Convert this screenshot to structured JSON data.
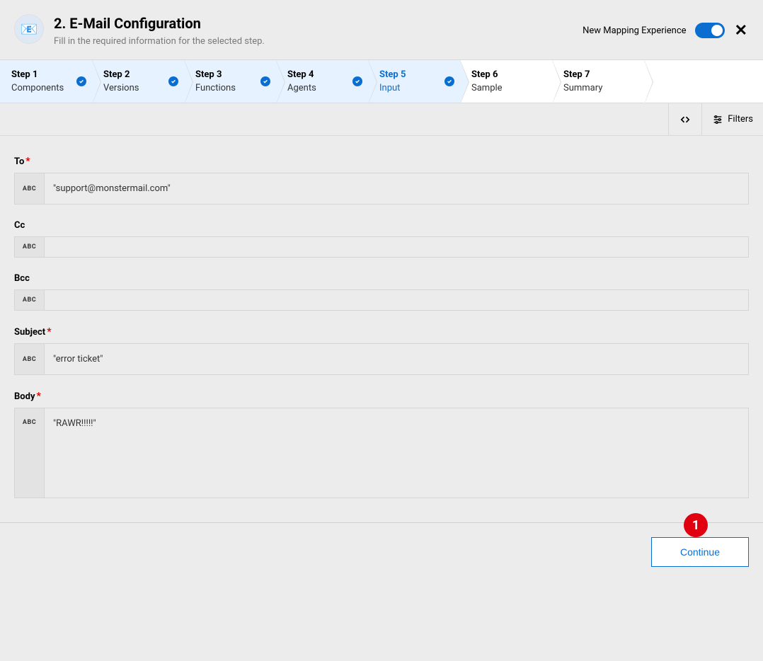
{
  "header": {
    "title": "2. E-Mail Configuration",
    "subtitle": "Fill in the required information for the selected step.",
    "icon_emoji": "📧",
    "toggle_label": "New Mapping Experience"
  },
  "steps": [
    {
      "title": "Step 1",
      "sub": "Components",
      "status": "completed"
    },
    {
      "title": "Step 2",
      "sub": "Versions",
      "status": "completed"
    },
    {
      "title": "Step 3",
      "sub": "Functions",
      "status": "completed"
    },
    {
      "title": "Step 4",
      "sub": "Agents",
      "status": "completed"
    },
    {
      "title": "Step 5",
      "sub": "Input",
      "status": "active"
    },
    {
      "title": "Step 6",
      "sub": "Sample",
      "status": "pending"
    },
    {
      "title": "Step 7",
      "sub": "Summary",
      "status": "pending"
    }
  ],
  "toolbar": {
    "filters_label": "Filters"
  },
  "fields": {
    "to": {
      "label": "To",
      "required": true,
      "prefix": "ABC",
      "value": "\"support@monstermail.com\""
    },
    "cc": {
      "label": "Cc",
      "required": false,
      "prefix": "ABC",
      "value": ""
    },
    "bcc": {
      "label": "Bcc",
      "required": false,
      "prefix": "ABC",
      "value": ""
    },
    "subject": {
      "label": "Subject",
      "required": true,
      "prefix": "ABC",
      "value": "\"error ticket\""
    },
    "body": {
      "label": "Body",
      "required": true,
      "prefix": "ABC",
      "value": "\"RAWR!!!!!\""
    }
  },
  "footer": {
    "continue_label": "Continue",
    "overlay_badge": "1"
  },
  "required_marker": "*"
}
